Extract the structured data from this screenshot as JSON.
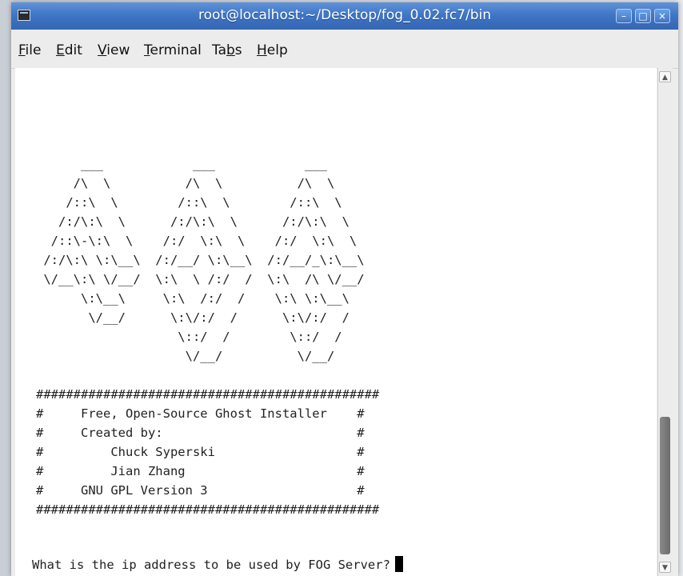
{
  "window": {
    "title": "root@localhost:~/Desktop/fog_0.02.fc7/bin",
    "minimize_glyph": "–",
    "maximize_glyph": "□",
    "close_glyph": "×"
  },
  "menubar": {
    "items": [
      {
        "mnemonic": "F",
        "rest": "ile"
      },
      {
        "mnemonic": "E",
        "rest": "dit"
      },
      {
        "mnemonic": "V",
        "rest": "iew"
      },
      {
        "mnemonic": "T",
        "rest": "erminal"
      },
      {
        "pre": "Ta",
        "mnemonic": "b",
        "rest": "s"
      },
      {
        "mnemonic": "H",
        "rest": "elp"
      }
    ]
  },
  "terminal": {
    "output": "\n\n\n\n      ___            ___            ___\n     /\\  \\          /\\  \\          /\\  \\\n    /::\\  \\        /::\\  \\        /::\\  \\\n   /:/\\:\\  \\      /:/\\:\\  \\      /:/\\:\\  \\\n  /::\\-\\:\\  \\    /:/  \\:\\  \\    /:/  \\:\\  \\\n /:/\\:\\ \\:\\__\\  /:/__/ \\:\\__\\  /:/__/_\\:\\__\\\n \\/__\\:\\ \\/__/  \\:\\  \\ /:/  /  \\:\\  /\\ \\/__/\n      \\:\\__\\     \\:\\  /:/  /    \\:\\ \\:\\__\\\n       \\/__/      \\:\\/:/  /      \\:\\/:/  /\n                   \\::/  /        \\::/  /\n                    \\/__/          \\/__/\n\n##############################################\n#     Free, Open-Source Ghost Installer    #\n#     Created by:                          #\n#         Chuck Syperski                   #\n#         Jian Zhang                       #\n#     GNU GPL Version 3                    #\n##############################################",
    "prompt": "What is the ip address to be used by FOG Server?"
  },
  "scrollbar": {
    "up_glyph": "▲",
    "down_glyph": "▼"
  }
}
